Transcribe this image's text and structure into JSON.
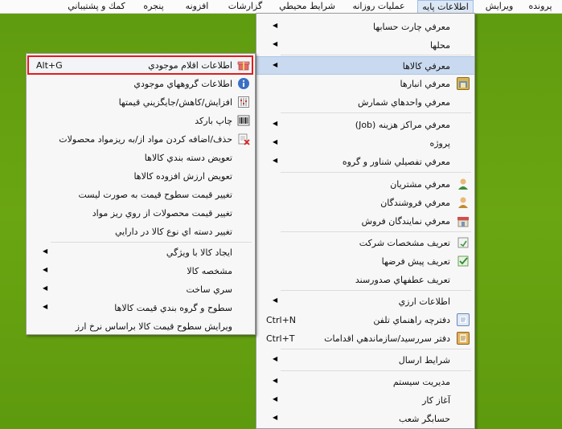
{
  "menubar": {
    "items": [
      "پرونده",
      "ويرايش",
      "اطلاعات پايه",
      "عمليات روزانه",
      "شرايط محيطي",
      "گزارشات",
      "افزونه",
      "پنجره",
      "كمك و پشتيباني"
    ]
  },
  "main_menu": {
    "items": [
      {
        "label": "معرفي چارت حسابها",
        "submenu": true
      },
      {
        "label": "محلها",
        "submenu": true
      },
      {
        "label": "معرفي كالاها",
        "submenu": true
      },
      {
        "label": "معرفي انبارها",
        "icon": "warehouse-icon"
      },
      {
        "label": "معرفي  واحدهاي شمارش"
      },
      {
        "label": "معرفي مراكز هزينه (Job)",
        "submenu": true
      },
      {
        "label": "پروژه",
        "submenu": true
      },
      {
        "label": "معرفي تفصيلي شناور و گروه",
        "submenu": true
      },
      {
        "label": "معرفي مشتريان",
        "icon": "customer-icon"
      },
      {
        "label": "معرفي فروشندگان",
        "icon": "seller-icon"
      },
      {
        "label": "معرفي نمايندگان فروش",
        "icon": "shop-icon"
      },
      {
        "label": "تعريف مشخصات شركت",
        "icon": "company-icon"
      },
      {
        "label": "تعريف پيش فرضها",
        "icon": "defaults-icon"
      },
      {
        "label": "تعريف عطفهاي صدورسند"
      },
      {
        "label": "اطلاعات ارزي",
        "submenu": true
      },
      {
        "label": "دفترچه راهنماي تلفن",
        "shortcut": "Ctrl+N",
        "icon": "phonebook-icon"
      },
      {
        "label": "دفتر سررسيد/سازماندهي اقدامات",
        "shortcut": "Ctrl+T",
        "icon": "planner-icon"
      },
      {
        "label": "شرايط ارسال",
        "submenu": true
      },
      {
        "label": "مديريت سيستم",
        "submenu": true
      },
      {
        "label": "آغاز كار",
        "submenu": true
      },
      {
        "label": "حسابگر شعب",
        "submenu": true
      }
    ]
  },
  "sub_menu": {
    "items": [
      {
        "label": "اطلاعات اقلام موجودي",
        "shortcut": "Alt+G",
        "icon": "gift-icon"
      },
      {
        "label": "اطلاعات گروههاي موجودي",
        "icon": "info-icon"
      },
      {
        "label": "افزايش/كاهش/جايگزيني قيمتها",
        "icon": "adjust-icon"
      },
      {
        "label": "چاپ باركد",
        "icon": "barcode-icon"
      },
      {
        "label": "حذف/اضافه كردن مواد از/به ريزمواد محصولات",
        "icon": "delete-materials-icon"
      },
      {
        "label": "تعويض دسته بندي كالاها"
      },
      {
        "label": "تعويض ارزش افزوده كالاها"
      },
      {
        "label": "تغيير قيمت سطوح قيمت به صورت ليست"
      },
      {
        "label": "تغيير قيمت محصولات از روي ريز مواد"
      },
      {
        "label": "تغيير دسته اي نوع كالا در دارايي"
      },
      {
        "label": "ايجاد كالا با ويژگي",
        "submenu": true
      },
      {
        "label": "مشخصه كالا",
        "submenu": true
      },
      {
        "label": "سري ساخت",
        "submenu": true
      },
      {
        "label": "سطوح و گروه بندي قيمت كالاها",
        "submenu": true
      },
      {
        "label": "ويرايش سطوح قيمت كالا براساس نرخ ارز"
      }
    ]
  }
}
